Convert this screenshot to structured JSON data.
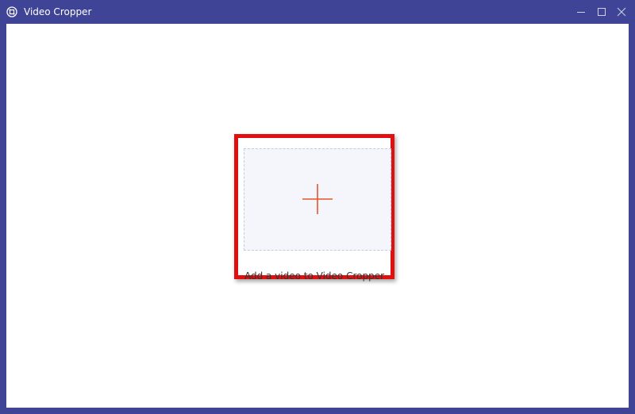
{
  "window": {
    "title": "Video Cropper",
    "controls": {
      "minimize_icon": "minimize-icon",
      "maximize_icon": "maximize-icon",
      "close_icon": "close-icon"
    }
  },
  "main": {
    "drop_zone_icon": "plus-icon",
    "add_label": "Add a video to Video Cropper"
  },
  "colors": {
    "frame": "#3f4496",
    "accent_plus": "#e8542b",
    "highlight": "#e01010",
    "drop_zone_bg": "#f4f6fb"
  }
}
